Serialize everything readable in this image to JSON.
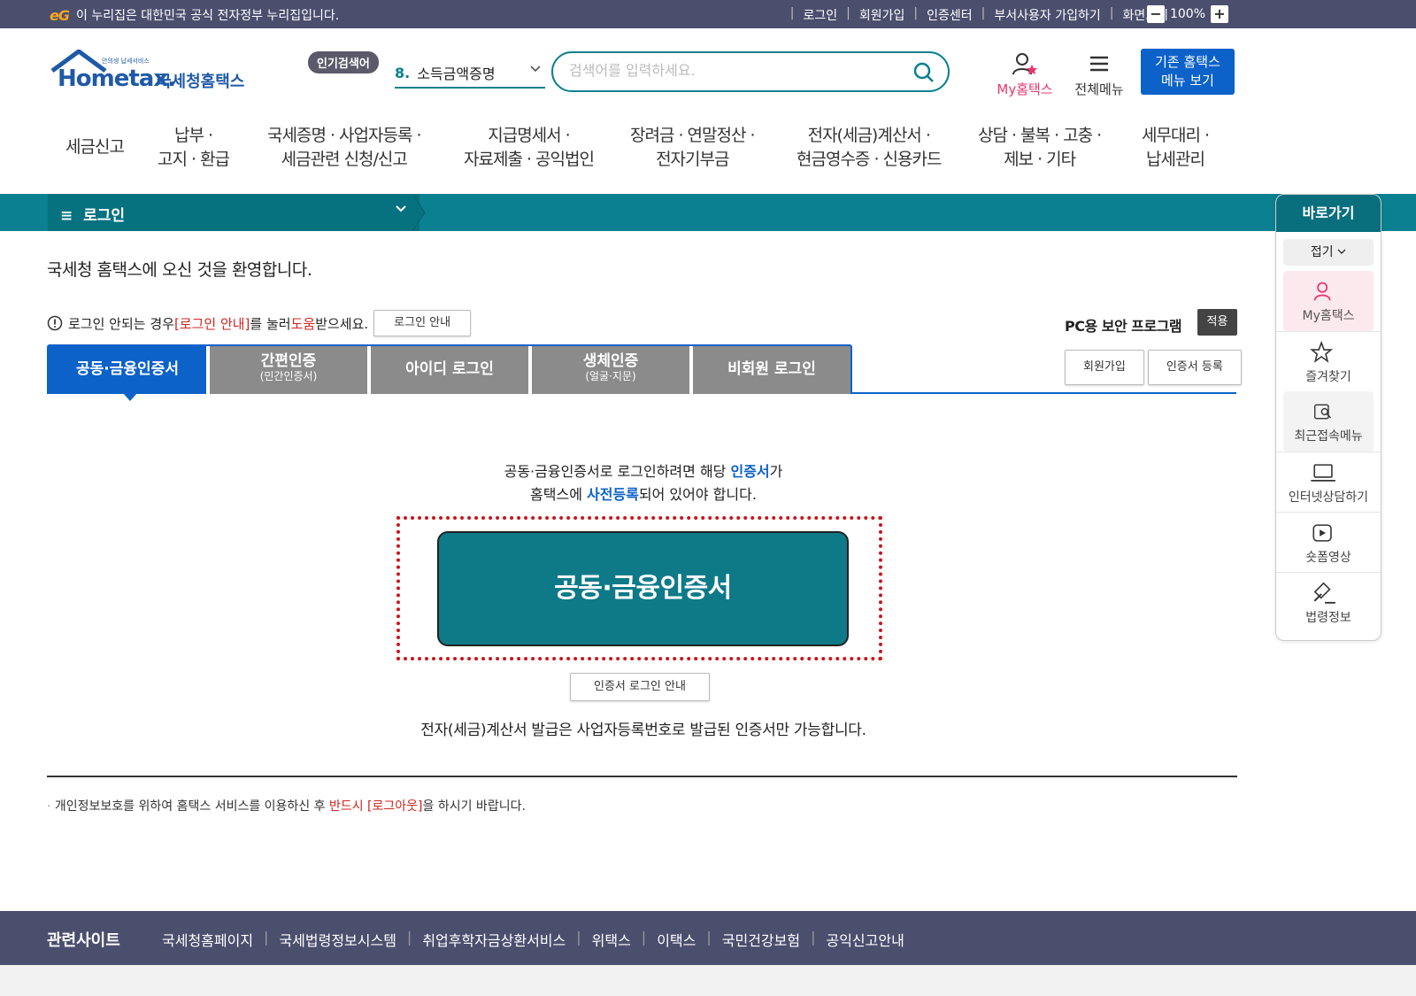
{
  "gov_banner": {
    "logo_text": "eG",
    "text": "이 누리집은 대한민국 공식 전자정부 누리집입니다.",
    "links": [
      "로그인",
      "회원가입",
      "인증센터",
      "부서사용자 가입하기",
      "화면크기"
    ],
    "zoom": "100%"
  },
  "header": {
    "logo_tiny": "안의생 납세서비스",
    "logo_hometax": "Hometax.",
    "logo_name": "국세청홈택스",
    "popular_badge": "인기검색어",
    "popular_num": "8.",
    "popular_term": "소득금액증명",
    "search_placeholder": "검색어를 입력하세요.",
    "my_label": "My홈택스",
    "all_menu_label": "전체메뉴",
    "old_menu_line1": "기존 홈택스",
    "old_menu_line2": "메뉴 보기"
  },
  "gnb": [
    {
      "line1": "세금신고",
      "line2": ""
    },
    {
      "line1": "납부 ·",
      "line2": "고지 · 환급"
    },
    {
      "line1": "국세증명 · 사업자등록 ·",
      "line2": "세금관련 신청/신고"
    },
    {
      "line1": "지급명세서 ·",
      "line2": "자료제출 · 공익법인"
    },
    {
      "line1": "장려금 · 연말정산 ·",
      "line2": "전자기부금"
    },
    {
      "line1": "전자(세금)계산서 ·",
      "line2": "현금영수증 · 신용카드"
    },
    {
      "line1": "상담 · 불복 · 고충 ·",
      "line2": "제보 · 기타"
    },
    {
      "line1": "세무대리 ·",
      "line2": "납세관리"
    }
  ],
  "breadcrumb": {
    "menu_icon": "≡",
    "current": "로그인"
  },
  "quick": {
    "title": "바로가기",
    "fold": "접기",
    "items": [
      "My홈택스",
      "즐겨찾기",
      "최근접속메뉴",
      "인터넷상담하기",
      "숏폼영상",
      "법령정보"
    ]
  },
  "content": {
    "welcome": "국세청 홈택스에 오신 것을 환영합니다.",
    "notice_pre": "로그인 안되는 경우 ",
    "notice_link": "[로그인 안내]",
    "notice_mid": "를 눌러 ",
    "notice_help": "도움",
    "notice_post": "받으세요.",
    "login_guide_btn": "로그인 안내",
    "pc_security": "PC용 보안 프로그램",
    "apply_btn": "적용",
    "signup_btn": "회원가입",
    "cert_register_btn": "인증서 등록",
    "tabs": [
      {
        "label": "공동·금융인증서",
        "sub": ""
      },
      {
        "label": "간편인증",
        "sub": "(민간인증서)"
      },
      {
        "label": "아이디 로그인",
        "sub": ""
      },
      {
        "label": "생체인증",
        "sub": "(얼굴·지문)"
      },
      {
        "label": "비회원 로그인",
        "sub": ""
      }
    ],
    "cert_msg1_pre": "공동·금융인증서로 로그인하려면 해당 ",
    "cert_msg1_blue": "인증서",
    "cert_msg1_post": "가",
    "cert_msg2_pre": "홈택스에 ",
    "cert_msg2_blue": "사전등록",
    "cert_msg2_post": "되어 있어야 합니다.",
    "cert_button": "공동·금융인증서",
    "cert_guide_btn": "인증서 로그인 안내",
    "etax_msg": "전자(세금)계산서 발급은 사업자등록번호로 발급된 인증서만 가능합니다.",
    "privacy_pre": "개인정보보호를 위하여 홈택스 서비스를 이용하신 후 ",
    "privacy_red": "반드시 [로그아웃]",
    "privacy_post": "을 하시기 바랍니다."
  },
  "footer": {
    "title": "관련사이트",
    "links": [
      "국세청홈페이지",
      "국세법령정보시스템",
      "취업후학자금상환서비스",
      "위택스",
      "이택스",
      "국민건강보험",
      "공익신고안내"
    ]
  },
  "colors": {
    "teal": "#0a8090",
    "blue": "#0c62c9",
    "red": "#d0241e",
    "nav_dark": "#4b4f6e"
  }
}
